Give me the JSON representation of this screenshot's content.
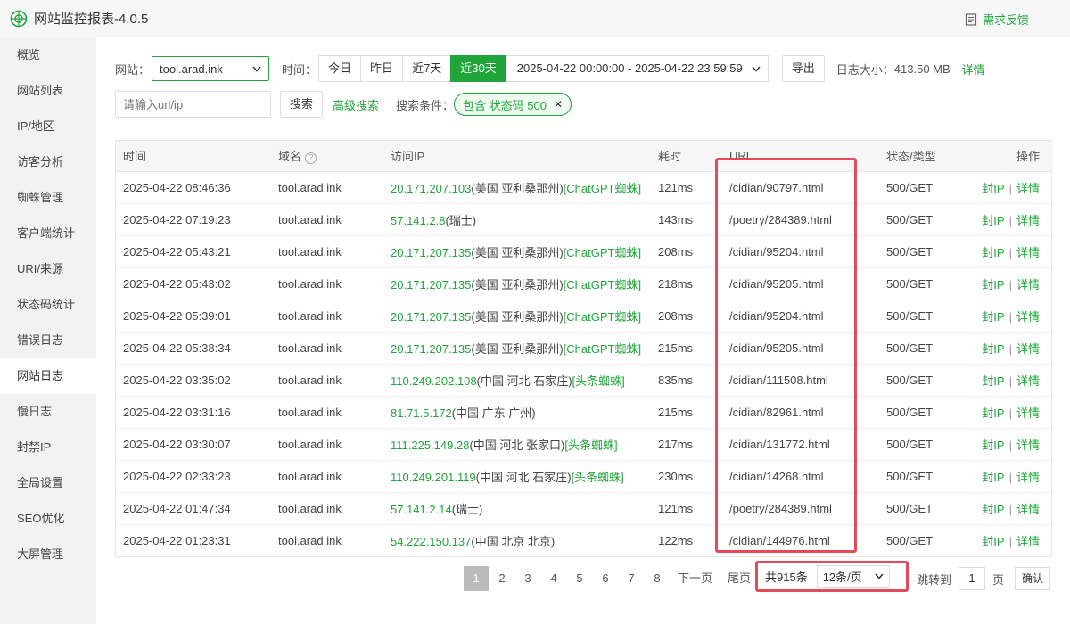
{
  "window": {
    "title": "网站监控报表-4.0.5",
    "feedback": "需求反馈"
  },
  "sidebar": {
    "items": [
      {
        "label": "概览"
      },
      {
        "label": "网站列表"
      },
      {
        "label": "IP/地区"
      },
      {
        "label": "访客分析"
      },
      {
        "label": "蜘蛛管理"
      },
      {
        "label": "客户端统计"
      },
      {
        "label": "URI/来源"
      },
      {
        "label": "状态码统计"
      },
      {
        "label": "错误日志"
      },
      {
        "label": "网站日志",
        "active": true
      },
      {
        "label": "慢日志"
      },
      {
        "label": "封禁IP"
      },
      {
        "label": "全局设置"
      },
      {
        "label": "SEO优化"
      },
      {
        "label": "大屏管理"
      }
    ]
  },
  "filters": {
    "site_label": "网站：",
    "site_value": "tool.arad.ink",
    "time_label": "时间：",
    "time_buttons": [
      "今日",
      "昨日",
      "近7天",
      "近30天"
    ],
    "time_active": "近30天",
    "date_range": "2025-04-22 00:00:00 - 2025-04-22 23:59:59",
    "export": "导出",
    "log_size_label": "日志大小：",
    "log_size_value": "413.50 MB",
    "details_link": "详情",
    "search_placeholder": "请输入url/ip",
    "search_button": "搜索",
    "advanced_search": "高级搜索",
    "conditions_label": "搜索条件：",
    "condition_tag": "包含 状态码 500",
    "condition_close": "✕"
  },
  "table": {
    "headers": {
      "time": "时间",
      "domain": "域名",
      "ip": "访问IP",
      "cost": "耗时",
      "url": "URL",
      "status": "状态/类型",
      "ops": "操作"
    },
    "op_block": "封IP",
    "op_detail": "详情",
    "rows": [
      {
        "time": "2025-04-22 08:46:36",
        "domain": "tool.arad.ink",
        "ip": "20.171.207.103",
        "loc": "(美国 亚利桑那州)",
        "spider": "[ChatGPT蜘蛛]",
        "cost": "121ms",
        "url": "/cidian/90797.html",
        "status": "500/GET"
      },
      {
        "time": "2025-04-22 07:19:23",
        "domain": "tool.arad.ink",
        "ip": "57.141.2.8",
        "loc": "(瑞士)",
        "spider": "",
        "cost": "143ms",
        "url": "/poetry/284389.html",
        "status": "500/GET"
      },
      {
        "time": "2025-04-22 05:43:21",
        "domain": "tool.arad.ink",
        "ip": "20.171.207.135",
        "loc": "(美国 亚利桑那州)",
        "spider": "[ChatGPT蜘蛛]",
        "cost": "208ms",
        "url": "/cidian/95204.html",
        "status": "500/GET"
      },
      {
        "time": "2025-04-22 05:43:02",
        "domain": "tool.arad.ink",
        "ip": "20.171.207.135",
        "loc": "(美国 亚利桑那州)",
        "spider": "[ChatGPT蜘蛛]",
        "cost": "218ms",
        "url": "/cidian/95205.html",
        "status": "500/GET"
      },
      {
        "time": "2025-04-22 05:39:01",
        "domain": "tool.arad.ink",
        "ip": "20.171.207.135",
        "loc": "(美国 亚利桑那州)",
        "spider": "[ChatGPT蜘蛛]",
        "cost": "208ms",
        "url": "/cidian/95204.html",
        "status": "500/GET"
      },
      {
        "time": "2025-04-22 05:38:34",
        "domain": "tool.arad.ink",
        "ip": "20.171.207.135",
        "loc": "(美国 亚利桑那州)",
        "spider": "[ChatGPT蜘蛛]",
        "cost": "215ms",
        "url": "/cidian/95205.html",
        "status": "500/GET"
      },
      {
        "time": "2025-04-22 03:35:02",
        "domain": "tool.arad.ink",
        "ip": "110.249.202.108",
        "loc": "(中国 河北 石家庄)",
        "spider": "[头条蜘蛛]",
        "cost": "835ms",
        "url": "/cidian/111508.html",
        "status": "500/GET"
      },
      {
        "time": "2025-04-22 03:31:16",
        "domain": "tool.arad.ink",
        "ip": "81.71.5.172",
        "loc": "(中国 广东 广州)",
        "spider": "",
        "cost": "215ms",
        "url": "/cidian/82961.html",
        "status": "500/GET"
      },
      {
        "time": "2025-04-22 03:30:07",
        "domain": "tool.arad.ink",
        "ip": "111.225.149.28",
        "loc": "(中国 河北 张家口)",
        "spider": "[头条蜘蛛]",
        "cost": "217ms",
        "url": "/cidian/131772.html",
        "status": "500/GET"
      },
      {
        "time": "2025-04-22 02:33:23",
        "domain": "tool.arad.ink",
        "ip": "110.249.201.119",
        "loc": "(中国 河北 石家庄)",
        "spider": "[头条蜘蛛]",
        "cost": "230ms",
        "url": "/cidian/14268.html",
        "status": "500/GET"
      },
      {
        "time": "2025-04-22 01:47:34",
        "domain": "tool.arad.ink",
        "ip": "57.141.2.14",
        "loc": "(瑞士)",
        "spider": "",
        "cost": "121ms",
        "url": "/poetry/284389.html",
        "status": "500/GET"
      },
      {
        "time": "2025-04-22 01:23:31",
        "domain": "tool.arad.ink",
        "ip": "54.222.150.137",
        "loc": "(中国 北京 北京)",
        "spider": "",
        "cost": "122ms",
        "url": "/cidian/144976.html",
        "status": "500/GET"
      }
    ]
  },
  "pagination": {
    "pages": [
      "1",
      "2",
      "3",
      "4",
      "5",
      "6",
      "7",
      "8"
    ],
    "current": "1",
    "next": "下一页",
    "last": "尾页",
    "total": "共915条",
    "page_size": "12条/页",
    "jump_label": "跳转到",
    "jump_value": "1",
    "page_unit": "页",
    "confirm": "确认"
  },
  "colors": {
    "accent": "#20a53a",
    "highlight": "#e24b5b"
  }
}
